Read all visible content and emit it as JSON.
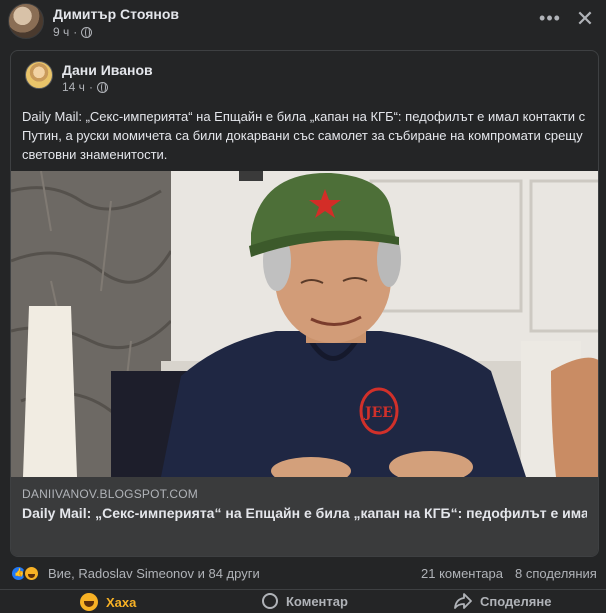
{
  "post": {
    "author": "Димитър Стоянов",
    "time": "9 ч",
    "more_icon": "more-horizontal-icon",
    "close_icon": "close-icon"
  },
  "shared_post": {
    "author": "Дани Иванов",
    "time": "14 ч",
    "text": "Daily Mail: „Секс-империята“ на Епщайн е била „капан на КГБ“: педофилът е имал контакти с Путин, а руски момичета са били докарвани със самолет за събиране на компромати срещу световни знаменитости.",
    "link_domain": "DANIIVANOV.BLOGSPOT.COM",
    "link_title": "Daily Mail: „Секс-империята“ на Епщайн е била „капан на КГБ“: педофилът е имал контакти с Путин, а руски момичета са били докарвани със самол",
    "photo_monogram": "JEE"
  },
  "stats": {
    "reaction_names": "Вие, Radoslav Simeonov и 84 други",
    "comments": "21 коментара",
    "shares": "8 споделяния"
  },
  "actions": {
    "haha_label": "Хаха",
    "comment_label": "Коментар",
    "share_label": "Споделяне"
  },
  "colors": {
    "background": "#242526",
    "link_card": "#3a3b3c",
    "haha": "#f7b125",
    "like": "#2078f4"
  }
}
